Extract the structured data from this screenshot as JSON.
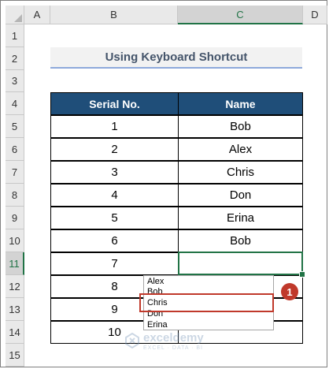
{
  "columns": [
    "A",
    "B",
    "C",
    "D"
  ],
  "rows": [
    "1",
    "2",
    "3",
    "4",
    "5",
    "6",
    "7",
    "8",
    "9",
    "10",
    "11",
    "12",
    "13",
    "14",
    "15"
  ],
  "title": "Using Keyboard Shortcut",
  "table": {
    "headers": [
      "Serial No.",
      "Name"
    ],
    "rows": [
      [
        "1",
        "Bob"
      ],
      [
        "2",
        "Alex"
      ],
      [
        "3",
        "Chris"
      ],
      [
        "4",
        "Don"
      ],
      [
        "5",
        "Erina"
      ],
      [
        "6",
        "Bob"
      ],
      [
        "7",
        ""
      ],
      [
        "8",
        ""
      ],
      [
        "9",
        ""
      ],
      [
        "10",
        ""
      ]
    ]
  },
  "active_cell": "C11",
  "dropdown": {
    "items": [
      "Alex",
      "Bob",
      "Chris",
      "Don",
      "Erina"
    ],
    "highlighted": "Chris"
  },
  "badge": "1",
  "watermark": {
    "name": "exceldemy",
    "tagline": "EXCEL · DATA · BI"
  },
  "colors": {
    "header_bg": "#1f4e79",
    "accent": "#217346",
    "highlight": "#c0392b"
  }
}
